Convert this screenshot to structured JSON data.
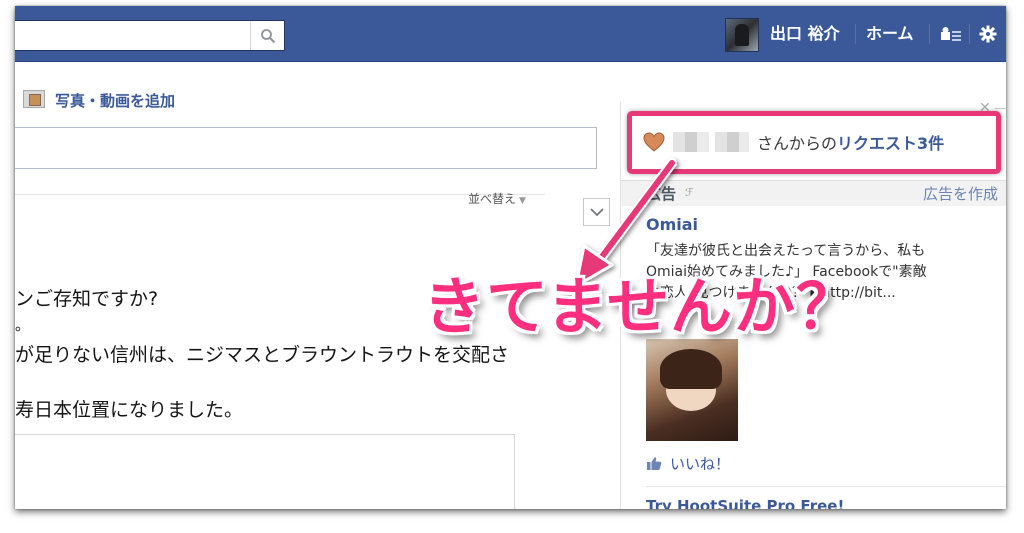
{
  "topbar": {
    "search": {
      "value": "",
      "placeholder": ""
    },
    "user_name": "出口 裕介",
    "home_label": "ホーム",
    "colors": {
      "bar": "#3b5998",
      "text": "#ffffff"
    }
  },
  "composer": {
    "add_photo_label": "写真・動画を追加",
    "status_value": ""
  },
  "feed": {
    "sort_label": "並べ替え",
    "post_lines": [
      "ンご存知ですか?",
      "。",
      "が足りない信州は、ニジマスとブラウントラウトを交配さ",
      "",
      "寿日本位置になりました。"
    ]
  },
  "sidebar": {
    "request_prefix": "さんからの",
    "request_link": "リクエスト3件",
    "ads_label": "広告",
    "create_ad_label": "広告を作成",
    "ad": {
      "title": "Omiai",
      "body_lines": [
        "「友達が彼氏と出会えたって言うから、私も",
        "Omiai始めてみました♪」 Facebookで\"素敵",
        "な恋人\"見つけませんか？ ▶http://bit..."
      ],
      "like_label": "いいね！"
    },
    "next_ad_title": "Try HootSuite Pro Free!"
  },
  "annotation": {
    "caption": "きてませんか？",
    "color": "#e73978"
  }
}
